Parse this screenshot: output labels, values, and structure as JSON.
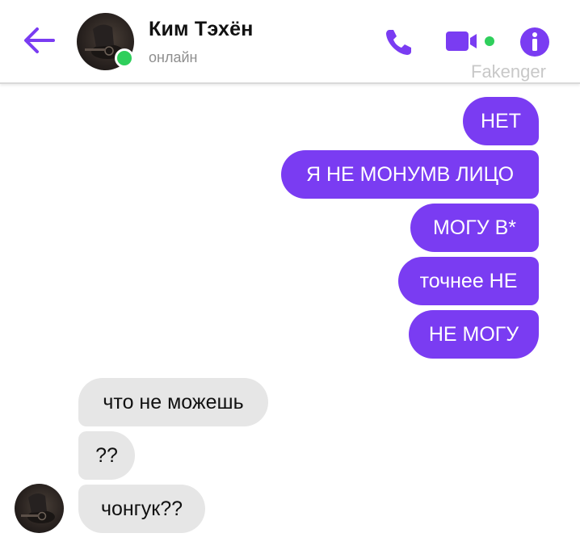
{
  "header": {
    "contact_name": "Ким Тэхён",
    "status": "онлайн",
    "watermark": "Fakenger",
    "accent_color": "#7a3cf2",
    "online_color": "#2fcf5c"
  },
  "outgoing_messages": [
    "НЕТ",
    "Я НЕ МОНУМВ ЛИЦО",
    "МОГУ В*",
    "точнее НЕ",
    "НЕ МОГУ"
  ],
  "incoming_messages": [
    "что не можешь",
    "??",
    "чонгук??"
  ],
  "icons": {
    "back": "back-arrow-icon",
    "phone": "phone-icon",
    "video": "video-camera-icon",
    "info": "info-icon"
  }
}
